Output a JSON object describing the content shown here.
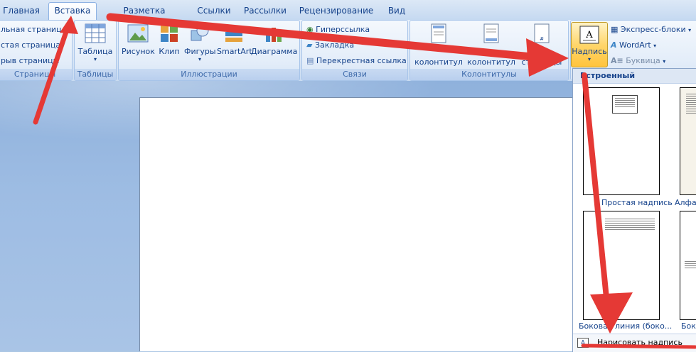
{
  "tabs": [
    "Главная",
    "Вставка",
    "Разметка страницы",
    "Ссылки",
    "Рассылки",
    "Рецензирование",
    "Вид"
  ],
  "active_tab": "Вставка",
  "groups": {
    "pages": {
      "items": [
        "льная страниц",
        "стая страница",
        "рыв страницы"
      ],
      "label": "Страницы"
    },
    "tables": {
      "button": "Таблица",
      "label": "Таблицы"
    },
    "illustrations": {
      "buttons": [
        "Рисунок",
        "Клип",
        "Фигуры",
        "SmartArt",
        "Диаграмма"
      ],
      "label": "Иллюстрации"
    },
    "links": {
      "items": [
        "Гиперссылка",
        "Закладка",
        "Перекрестная ссылка"
      ],
      "label": "Связи"
    },
    "headers": {
      "buttons": [
        "Верхний колонтитул",
        "Нижний колонтитул",
        "Номер страницы"
      ],
      "visible_lines": [
        "колонтитул",
        "колонтитул",
        "страницы"
      ],
      "label": "Колонтитулы"
    },
    "text": {
      "textbox": "Надпись",
      "items": [
        "Экспресс-блоки",
        "WordArt",
        "Буквица"
      ]
    }
  },
  "gallery": {
    "header": "Встроенный",
    "items": [
      "Простая надпись",
      "Алфавит",
      "Боковая линия (боко...",
      "Боко"
    ],
    "footer": "Нарисовать надпись"
  },
  "colors": {
    "accent": "#15428b",
    "annotation": "#e53935",
    "highlight": "#ffd66b"
  }
}
